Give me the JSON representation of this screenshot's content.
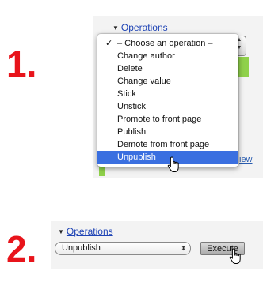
{
  "steps": {
    "first": "1",
    "second": "2",
    "dot": "."
  },
  "panel1": {
    "header_link": "Operations",
    "side_link": "iew",
    "dropdown": {
      "checked_index": 0,
      "selected_index": 9,
      "items": [
        "– Choose an operation –",
        "Change author",
        "Delete",
        "Change value",
        "Stick",
        "Unstick",
        "Promote to front page",
        "Publish",
        "Demote from front page",
        "Unpublish"
      ]
    }
  },
  "panel2": {
    "header_link": "Operations",
    "select_value": "Unpublish",
    "execute_label": "Execute"
  },
  "icons": {
    "expand_triangle": "triangle-down-icon",
    "stepper": "up-down-arrows-icon",
    "checkmark": "checkmark-icon",
    "cursor": "hand-pointer-icon"
  },
  "colors": {
    "step_number": "#e8141b",
    "link": "#1f44b5",
    "highlight": "#3a6fe0",
    "accent_green": "#8fd14a"
  }
}
